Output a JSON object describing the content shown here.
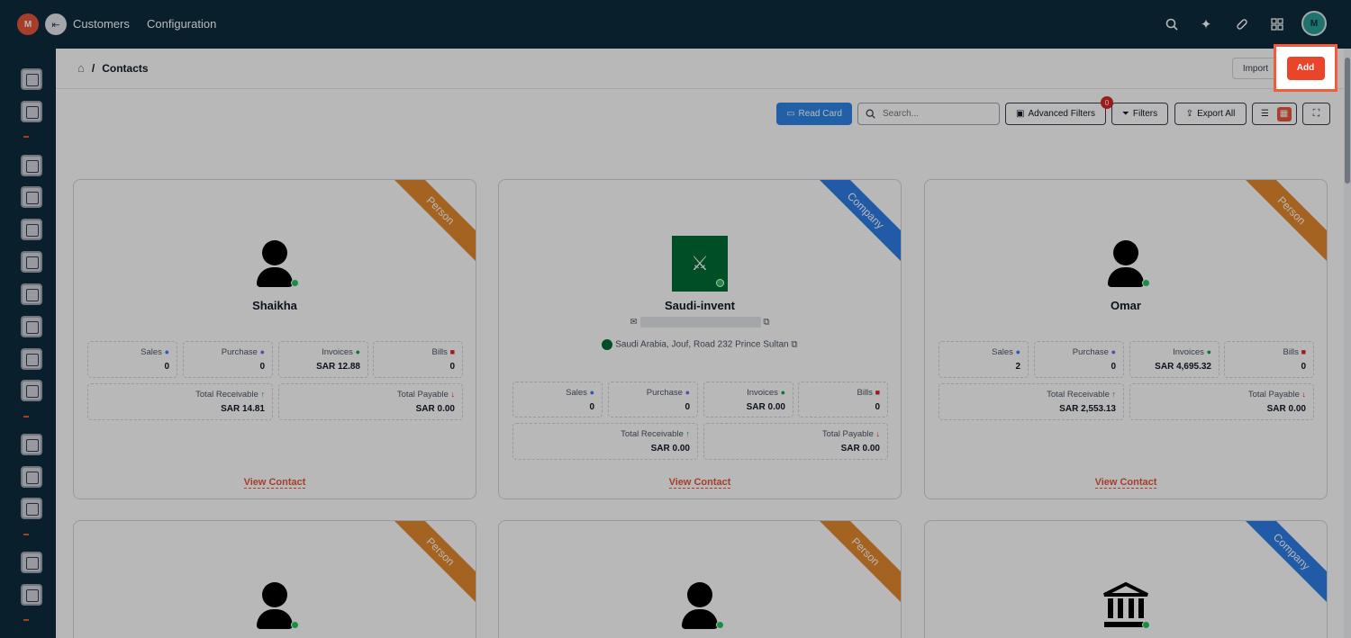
{
  "app": {
    "logo_text": "M",
    "avatar_text": "M"
  },
  "topnav": {
    "links": [
      "Customers",
      "Configuration"
    ]
  },
  "breadcrumb": {
    "current": "Contacts"
  },
  "header": {
    "import_label": "Import",
    "add_label": "Add"
  },
  "toolbar": {
    "read_card_label": "Read Card",
    "search_placeholder": "Search...",
    "advanced_filters_label": "Advanced Filters",
    "advanced_filters_count": "0",
    "filters_label": "Filters",
    "export_all_label": "Export All"
  },
  "icons": {
    "sidebar": [
      "notebook-icon",
      "chart-icon",
      "sales-icon",
      "bar-chart-icon",
      "document-icon",
      "clipboard-icon",
      "box-icon",
      "money-icon",
      "search-doc-icon",
      "calendar-icon",
      "headset-icon",
      "folder-icon",
      "monitor-icon",
      "settings-icon",
      "report-icon"
    ]
  },
  "colors": {
    "accent": "#e8573c",
    "navy": "#0f2b3d",
    "person_ribbon": "#e58a2e",
    "company_ribbon": "#2f7de8",
    "read_card": "#2f86e8"
  },
  "cards": [
    {
      "type": "Person",
      "name": "Shaikha",
      "stats": {
        "sales": "0",
        "purchase": "0",
        "invoices": "SAR 12.88",
        "bills": "0",
        "total_receivable": "SAR 14.81",
        "total_payable": "SAR 0.00"
      },
      "view_label": "View Contact"
    },
    {
      "type": "Company",
      "name": "Saudi-invent",
      "address": "Saudi Arabia,  Jouf,  Road 232 Prince Sultan",
      "stats": {
        "sales": "0",
        "purchase": "0",
        "invoices": "SAR 0.00",
        "bills": "0",
        "total_receivable": "SAR 0.00",
        "total_payable": "SAR 0.00"
      },
      "view_label": "View Contact"
    },
    {
      "type": "Person",
      "name": "Omar",
      "stats": {
        "sales": "2",
        "purchase": "0",
        "invoices": "SAR 4,695.32",
        "bills": "0",
        "total_receivable": "SAR 2,553.13",
        "total_payable": "SAR 0.00"
      },
      "view_label": "View Contact"
    },
    {
      "type": "Person"
    },
    {
      "type": "Person"
    },
    {
      "type": "Company"
    }
  ],
  "labels": {
    "sales": "Sales",
    "purchase": "Purchase",
    "invoices": "Invoices",
    "bills": "Bills",
    "total_receivable": "Total Receivable",
    "total_payable": "Total Payable"
  }
}
